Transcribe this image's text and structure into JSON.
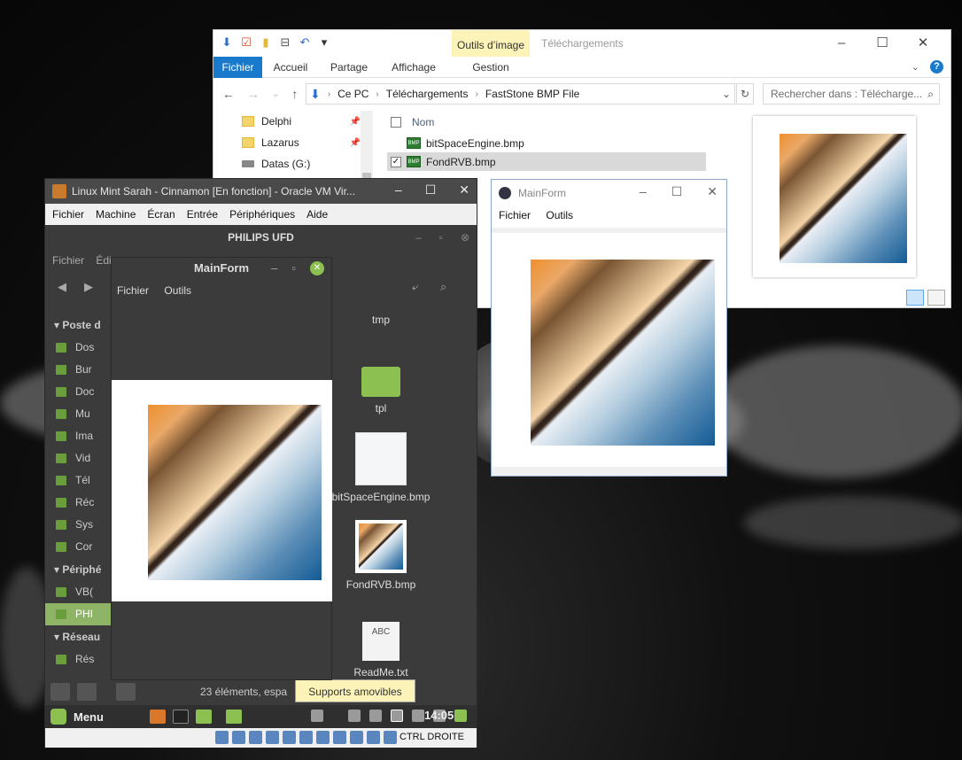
{
  "explorer": {
    "ribbon_context_tab": "Outils d’image",
    "title": "Téléchargements",
    "tabs": [
      "Fichier",
      "Accueil",
      "Partage",
      "Affichage",
      "Gestion"
    ],
    "breadcrumb": [
      "Ce PC",
      "Téléchargements",
      "FastStone BMP File"
    ],
    "search_placeholder": "Rechercher dans : Télécharge...",
    "nav_items": [
      {
        "label": "Delphi",
        "pinned": true
      },
      {
        "label": "Lazarus",
        "pinned": true
      },
      {
        "label": "Datas (G:)",
        "pinned": false
      }
    ],
    "column_name": "Nom",
    "files": [
      {
        "name": "bitSpaceEngine.bmp",
        "selected": false
      },
      {
        "name": "FondRVB.bmp",
        "selected": true
      }
    ]
  },
  "vbox": {
    "title": "Linux Mint Sarah - Cinnamon [En fonction] - Oracle VM Vir...",
    "menu": [
      "Fichier",
      "Machine",
      "Écran",
      "Entrée",
      "Périphériques",
      "Aide"
    ],
    "host_key": "CTRL DROITE"
  },
  "nemo": {
    "title": "PHILIPS UFD",
    "menu": [
      "Fichier",
      "Édi"
    ],
    "sidebar_sections": [
      "Poste d",
      "Périphé",
      "Réseau"
    ],
    "sidebar_items": [
      "Dos",
      "Bur",
      "Doc",
      "Mu",
      "Ima",
      "Vid",
      "Tél",
      "Réc",
      "Sys",
      "Cor",
      "VB(",
      "PHI",
      "Rés"
    ],
    "grid_items": [
      "tmp",
      "tpl",
      "bitSpaceEngine.bmp",
      "FondRVB.bmp",
      "ReadMe.txt"
    ],
    "txt_thumb": "ABC",
    "status": "23 éléments, espa",
    "tooltip": "Supports amovibles",
    "taskbar_menu": "Menu",
    "clock": "14:05"
  },
  "mint_mainform": {
    "title": "MainForm",
    "menu": [
      "Fichier",
      "Outils"
    ]
  },
  "win_mainform": {
    "title": "MainForm",
    "menu": [
      "Fichier",
      "Outils"
    ]
  },
  "colors": {
    "ribbon_blue": "#1979ca",
    "context_yellow": "#fcf3b8",
    "mint_green": "#8cc152"
  }
}
